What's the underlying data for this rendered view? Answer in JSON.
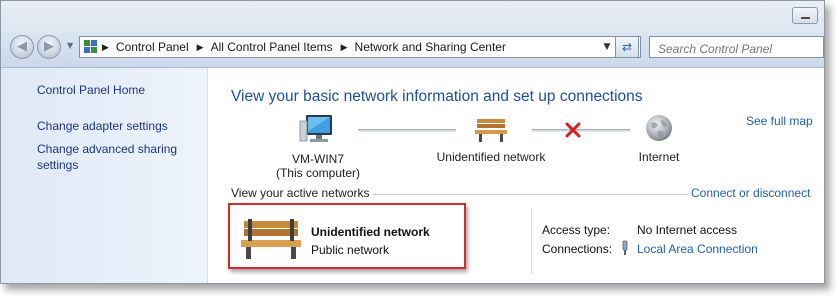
{
  "toolbar": {
    "breadcrumbs": [
      "Control Panel",
      "All Control Panel Items",
      "Network and Sharing Center"
    ],
    "search_placeholder": "Search Control Panel"
  },
  "sidebar": {
    "items": [
      {
        "label": "Control Panel Home"
      },
      {
        "label": "Change adapter settings"
      },
      {
        "label": "Change advanced sharing"
      },
      {
        "label": "settings"
      }
    ]
  },
  "main": {
    "heading": "View your basic network information and set up connections",
    "see_full_map": "See full map",
    "map": {
      "computer_name": "VM-WIN7",
      "computer_sub": "(This computer)",
      "network_name": "Unidentified network",
      "internet": "Internet"
    },
    "active_networks_label": "View your active networks",
    "connect_link": "Connect or disconnect",
    "active_network": {
      "name": "Unidentified network",
      "type": "Public network"
    },
    "access_type_label": "Access type:",
    "access_type_value": "No Internet access",
    "connections_label": "Connections:",
    "connections_value": "Local Area Connection"
  },
  "colors": {
    "link": "#1f5fb0",
    "heading": "#1e4fa6",
    "highlight_border": "#d5292c",
    "disconnect_x": "#d62020"
  }
}
